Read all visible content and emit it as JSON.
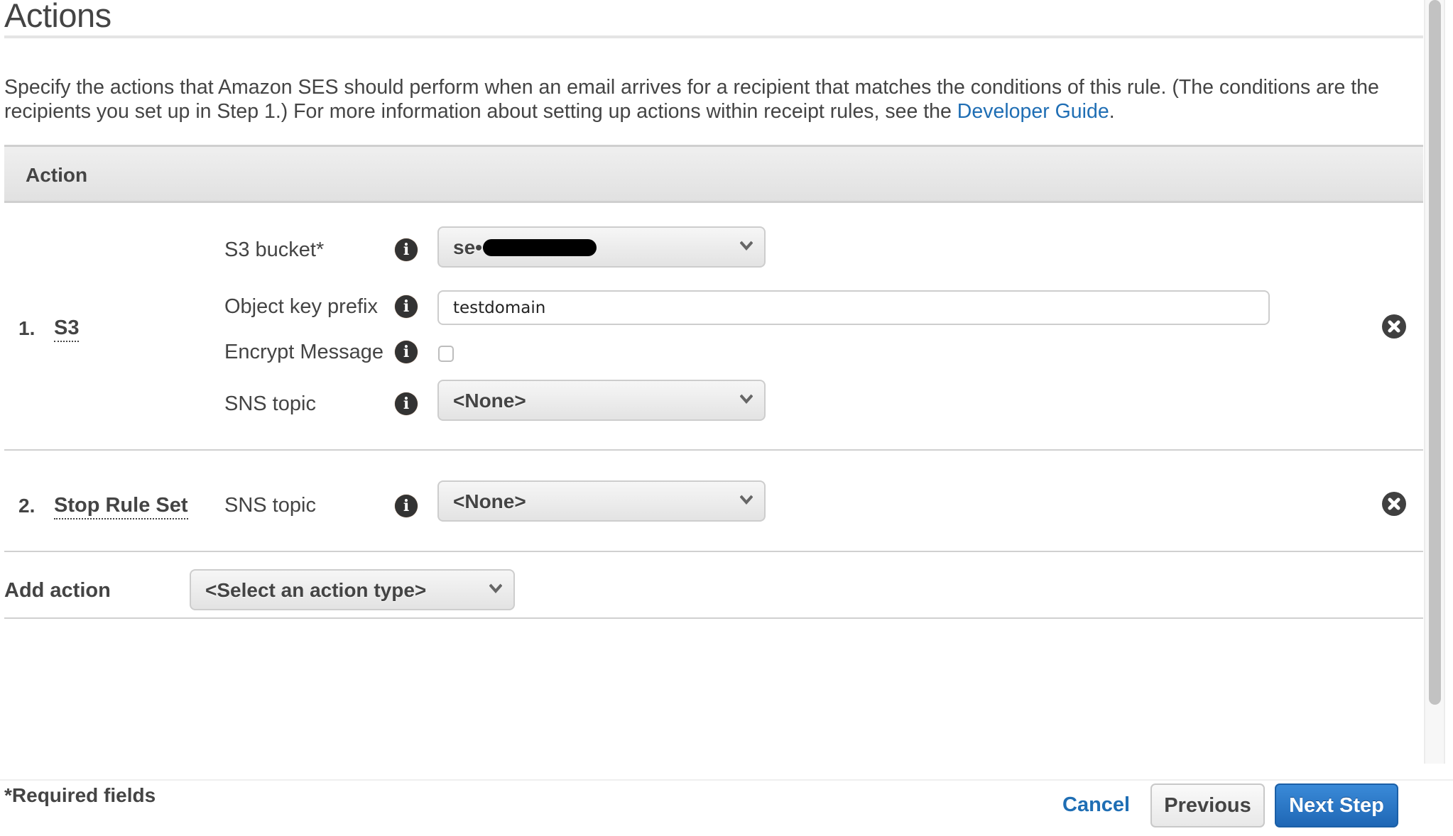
{
  "page": {
    "title": "Actions",
    "description": "Specify the actions that Amazon SES should perform when an email arrives for a recipient that matches the conditions of this rule. (The conditions are the recipients you set up in Step 1.) For more information about setting up actions within receipt rules, see the",
    "description_link": "Developer Guide",
    "description_end": "."
  },
  "table": {
    "header": "Action",
    "actions": [
      {
        "number": "1.",
        "name": "S3",
        "fields": {
          "s3_bucket": {
            "label": "S3 bucket*",
            "value": "se•••••••••",
            "redacted": true
          },
          "object_key_prefix": {
            "label": "Object key prefix",
            "value": "testdomain"
          },
          "encrypt_message": {
            "label": "Encrypt Message",
            "checked": false
          },
          "sns_topic": {
            "label": "SNS topic",
            "value": "<None>"
          }
        }
      },
      {
        "number": "2.",
        "name": "Stop Rule Set",
        "fields": {
          "sns_topic": {
            "label": "SNS topic",
            "value": "<None>"
          }
        }
      }
    ],
    "add_action": {
      "label": "Add action",
      "value": "<Select an action type>"
    }
  },
  "footer": {
    "required_note": "*Required fields",
    "cancel": "Cancel",
    "previous": "Previous",
    "next": "Next Step"
  },
  "icons": {
    "info": "info-circle-icon",
    "remove": "remove-circle-x-icon",
    "chevron": "chevron-down-icon"
  },
  "colors": {
    "link": "#1f6eb4",
    "primary_button": "#1f67b5",
    "text": "#444444"
  }
}
